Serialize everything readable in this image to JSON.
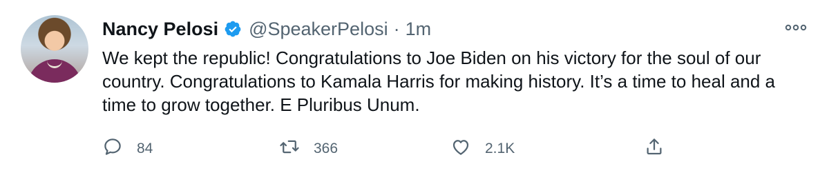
{
  "tweet": {
    "author_name": "Nancy Pelosi",
    "handle": "@SpeakerPelosi",
    "separator": "·",
    "timestamp": "1m",
    "text": "We kept the republic! Congratulations to Joe Biden on his victory for the soul of our country. Congratulations to Kamala Harris for making history. It’s a time to heal and a time to grow together. E Pluribus Unum.",
    "verified": true
  },
  "actions": {
    "replies": "84",
    "retweets": "366",
    "likes": "2.1K"
  },
  "icons": {
    "verified": "verified-badge-icon",
    "more": "more-options-icon",
    "reply": "reply-icon",
    "retweet": "retweet-icon",
    "like": "like-icon",
    "share": "share-icon"
  },
  "colors": {
    "text": "#0f1419",
    "secondary": "#536471",
    "verified_blue": "#1d9bf0"
  }
}
